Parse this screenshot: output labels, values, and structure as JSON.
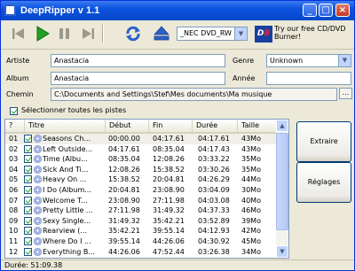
{
  "window": {
    "title": "DeepRipper v 1.1"
  },
  "toolbar": {
    "drive_value": "_NEC DVD_RW N",
    "promo_logo": "DB",
    "promo_text": "Try our free CD/DVD Burner!"
  },
  "form": {
    "artist_label": "Artiste",
    "artist_value": "Anastacia",
    "album_label": "Album",
    "album_value": "Anastacia",
    "genre_label": "Genre",
    "genre_value": "Unknown",
    "year_label": "Année",
    "year_value": "",
    "path_label": "Chemin",
    "path_value": "C:\\Documents and Settings\\Stef\\Mes documents\\Ma musique",
    "browse_label": "...",
    "select_all_label": "Sélectionner toutes les pistes"
  },
  "table": {
    "headers": [
      "?",
      "Titre",
      "Début",
      "Fin",
      "Durée",
      "Taille"
    ],
    "rows": [
      [
        "01",
        "Seasons Ch...",
        "00:00.00",
        "04:17.61",
        "04:17.61",
        "43Mo"
      ],
      [
        "02",
        "Left Outside...",
        "04:17.61",
        "08:35.04",
        "04:17.43",
        "43Mo"
      ],
      [
        "03",
        "Time (Albu...",
        "08:35.04",
        "12:08.26",
        "03:33.22",
        "35Mo"
      ],
      [
        "04",
        "Sick And Ti...",
        "12:08.26",
        "15:38.52",
        "03:30.26",
        "35Mo"
      ],
      [
        "05",
        "Heavy On ...",
        "15:38.52",
        "20:04.81",
        "04:26.29",
        "44Mo"
      ],
      [
        "06",
        "I Do (Album...",
        "20:04.81",
        "23:08.90",
        "03:04.09",
        "30Mo"
      ],
      [
        "07",
        "Welcome T...",
        "23:08.90",
        "27:11.98",
        "04:03.08",
        "40Mo"
      ],
      [
        "08",
        "Pretty Little ...",
        "27:11.98",
        "31:49.32",
        "04:37.33",
        "46Mo"
      ],
      [
        "09",
        "Sexy Single...",
        "31:49.32",
        "35:42.21",
        "03:52.89",
        "39Mo"
      ],
      [
        "10",
        "Rearview (...",
        "35:42.21",
        "39:55.14",
        "04:12.93",
        "42Mo"
      ],
      [
        "11",
        "Where Do I ...",
        "39:55.14",
        "44:26.06",
        "04:30.92",
        "45Mo"
      ],
      [
        "12",
        "Everything B...",
        "44:26.06",
        "47:52.44",
        "03:26.38",
        "34Mo"
      ]
    ]
  },
  "buttons": {
    "extract": "Extraire",
    "settings": "Réglages"
  },
  "status": {
    "duration": "Durée:  51:09.38"
  },
  "colors": {
    "title_bar": "#0a52dd",
    "play_green": "#21a121",
    "selection": "#f1f0e8"
  },
  "icons": [
    "skip-back-icon",
    "play-icon",
    "pause-icon",
    "skip-forward-icon",
    "refresh-icon",
    "eject-icon",
    "cd-icon",
    "checkbox-icon"
  ]
}
